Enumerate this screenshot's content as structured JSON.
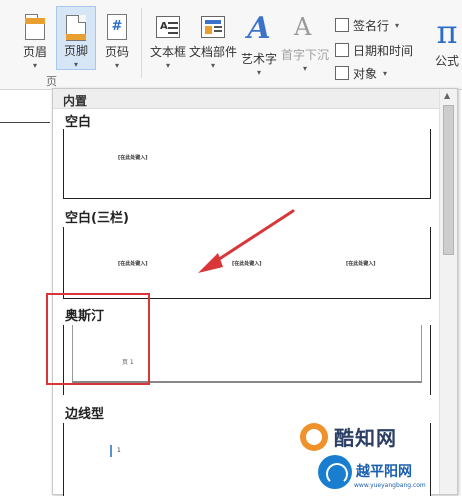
{
  "ribbon": {
    "buttons": [
      {
        "label": "页眉"
      },
      {
        "label": "页脚"
      },
      {
        "label": "页码"
      },
      {
        "label": "文本框"
      },
      {
        "label": "文档部件"
      },
      {
        "label": "艺术字"
      },
      {
        "label": "首字下沉"
      }
    ],
    "small_buttons": [
      {
        "label": "签名行"
      },
      {
        "label": "日期和时间"
      },
      {
        "label": "对象"
      }
    ],
    "equation": {
      "glyph": "π",
      "label": "公式"
    },
    "group_label_fragment": "页"
  },
  "gallery": {
    "header": "内置",
    "items": [
      {
        "title": "空白",
        "placeholders": [
          "[在此处键入]"
        ]
      },
      {
        "title": "空白(三栏)",
        "placeholders": [
          "[在此处键入]",
          "[在此处键入]",
          "[在此处键入]"
        ]
      },
      {
        "title": "奥斯汀",
        "page_number": "页 1"
      },
      {
        "title": "边线型",
        "page_number": "1"
      }
    ]
  },
  "watermarks": {
    "brand1": "酷知网",
    "brand2": "越平阳网",
    "url": "www.yueyangbang.com"
  },
  "colors": {
    "highlight": "#d9363a",
    "arrow": "#d9363a",
    "active_tab": "#d7e6f7"
  }
}
